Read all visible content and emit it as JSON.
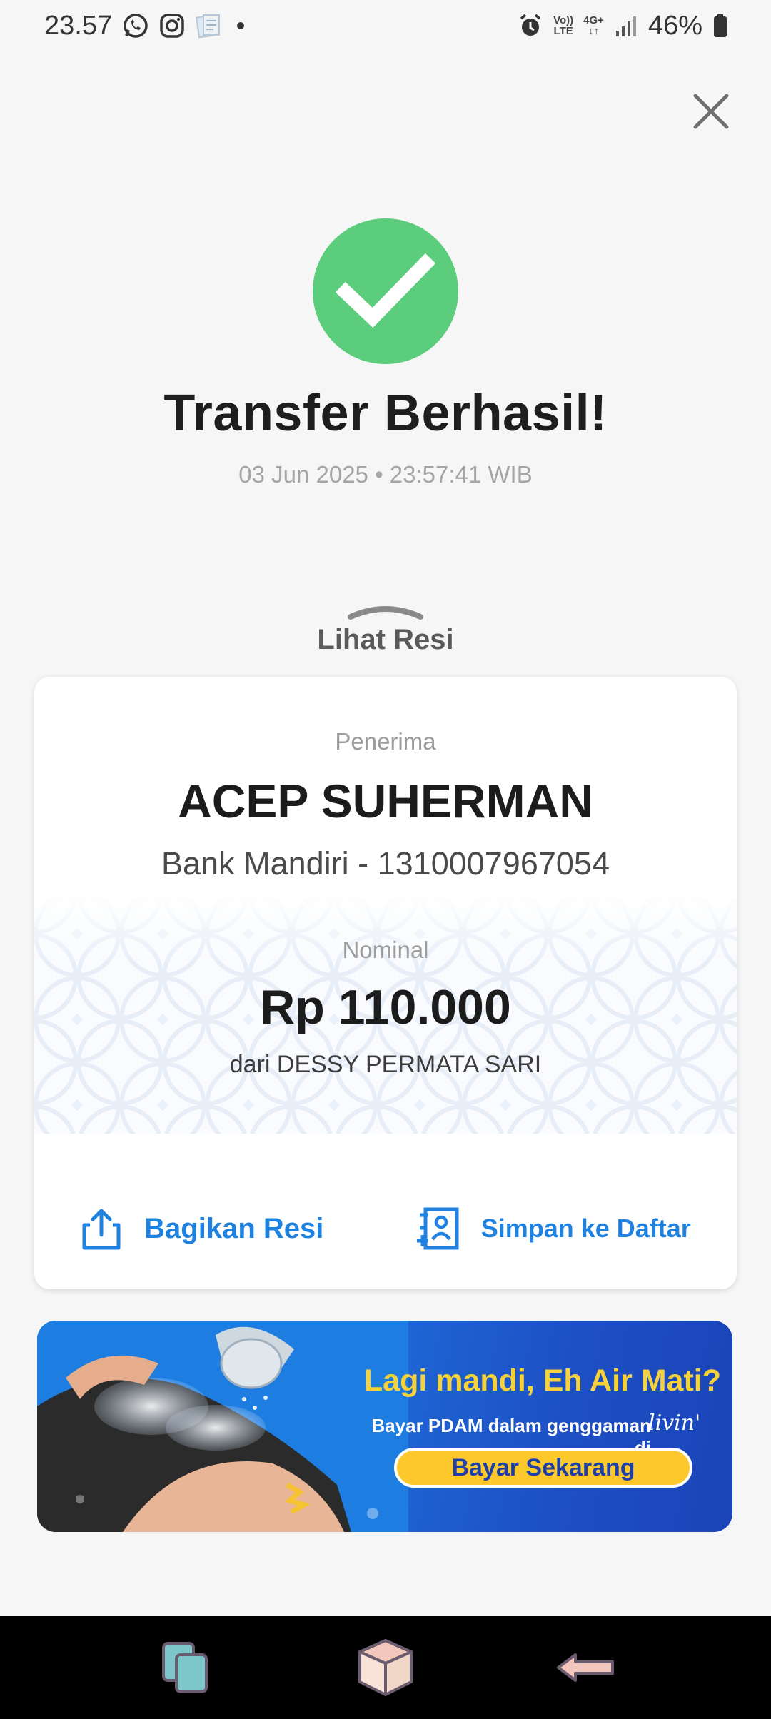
{
  "status_bar": {
    "time": "23.57",
    "net_top": "Vo))",
    "net_bottom": "LTE",
    "net2_top": "4G+",
    "battery": "46%",
    "icons": [
      "whatsapp-icon",
      "instagram-icon",
      "notes-icon",
      "dot-icon",
      "alarm-icon",
      "volte-icon",
      "4g-icon",
      "signal-icon",
      "battery-icon"
    ]
  },
  "header": {
    "close_icon": "close-icon"
  },
  "success": {
    "title": "Transfer Berhasil!",
    "timestamp": "03 Jun 2025 • 23:57:41 WIB",
    "icon_color": "#5ccd7d"
  },
  "receipt_toggle": {
    "label": "Lihat Resi"
  },
  "receipt": {
    "recipient_label": "Penerima",
    "recipient_name": "ACEP SUHERMAN",
    "recipient_account": "Bank Mandiri - 1310007967054",
    "amount_label": "Nominal",
    "amount": "Rp 110.000",
    "sender": "dari DESSY PERMATA SARI",
    "actions": {
      "share_label": "Bagikan Resi",
      "save_label": "Simpan ke Daftar"
    },
    "accent_color": "#1f82e1"
  },
  "banner": {
    "headline": "Lagi mandi, Eh Air Mati?",
    "sub": "Bayar PDAM dalam genggaman di",
    "logo": "livin'",
    "cta": "Bayar Sekarang"
  },
  "nav": {
    "items": [
      "recent-apps-icon",
      "home-icon",
      "back-icon"
    ]
  }
}
